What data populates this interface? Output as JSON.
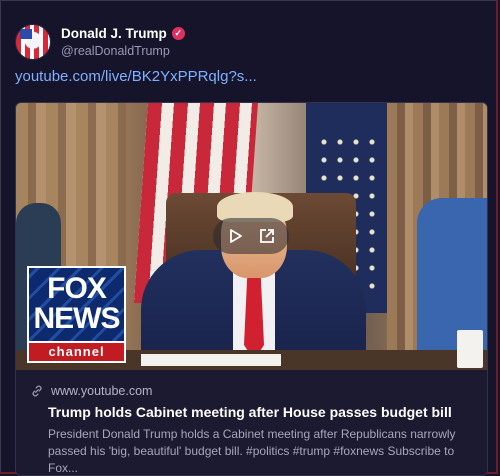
{
  "post": {
    "author_name": "Donald J. Trump",
    "author_handle": "@realDonaldTrump",
    "link_text": "youtube.com/live/BK2YxPPRqlg?s..."
  },
  "card": {
    "domain": "www.youtube.com",
    "title": "Trump holds Cabinet meeting after House passes budget bill",
    "description": "President Donald Trump holds a Cabinet meeting after Republicans narrowly passed his 'big, beautiful' budget bill. #politics #trump #foxnews Subscribe to Fox..."
  },
  "thumbnail": {
    "logo_line1": "FOX",
    "logo_line2": "NEWS",
    "logo_line3": "channel"
  },
  "icons": [
    "avatar",
    "verified-badge-icon",
    "play-icon",
    "external-link-icon",
    "link-icon"
  ],
  "colors": {
    "background": "#16142b",
    "link": "#7fb0ff",
    "verified": "#e0305f"
  }
}
